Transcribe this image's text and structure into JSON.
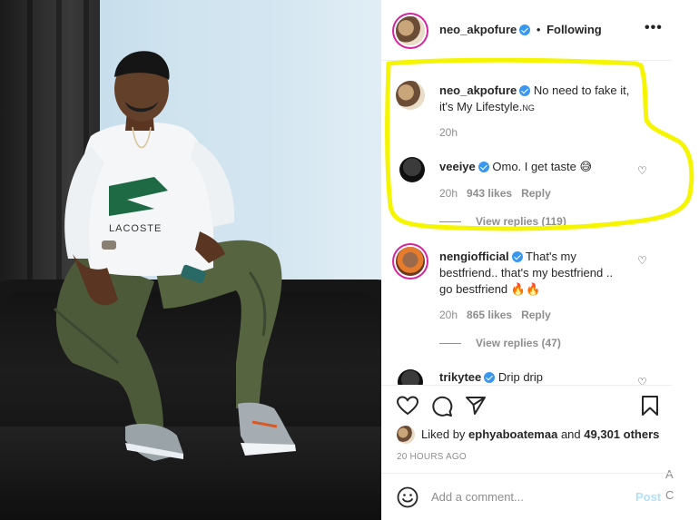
{
  "post": {
    "author": "neo_akpofure",
    "separator": "•",
    "follow_state": "Following",
    "more_label": "•••"
  },
  "caption": {
    "username": "neo_akpofure",
    "text_line1": "No need to fake it,",
    "text_line2": "it's My Lifestyle.",
    "text_suffix": "NG",
    "time": "20h"
  },
  "comments": [
    {
      "username": "veeiye",
      "line1": "Omo. I get taste 😅",
      "line2": "",
      "line3": "",
      "time": "20h",
      "likes": "943 likes",
      "reply": "Reply",
      "view_replies": "View replies (119)"
    },
    {
      "username": "nengiofficial",
      "line1": "That's my",
      "line2": "bestfriend.. that's my bestfriend ..",
      "line3": "go bestfriend 🔥🔥",
      "time": "20h",
      "likes": "865 likes",
      "reply": "Reply",
      "view_replies": "View replies (47)"
    },
    {
      "username": "trikytee",
      "line1": "Drip drip"
    }
  ],
  "likes": {
    "prefix": "Liked by",
    "user": "ephyaboatemaa",
    "joiner": "and",
    "others": "49,301 others"
  },
  "timestamp": "20 HOURS AGO",
  "composer": {
    "placeholder": "Add a comment...",
    "post_label": "Post"
  },
  "edge_glyphs": [
    "A",
    "C"
  ],
  "colors": {
    "highlight": "#f5f500",
    "verified": "#3897f0",
    "muted": "#8e8e8e",
    "post_disabled": "#b2dffc"
  }
}
